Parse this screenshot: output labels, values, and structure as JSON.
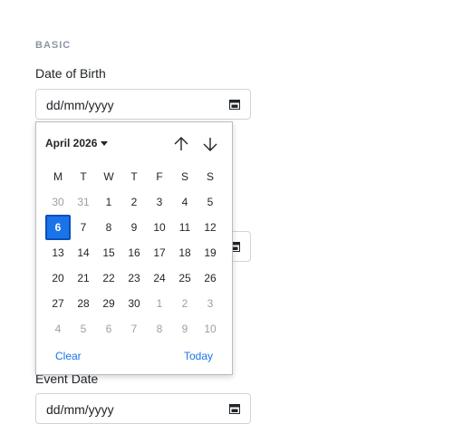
{
  "section": {
    "title": "BASIC"
  },
  "fields": {
    "dob": {
      "label": "Date of Birth",
      "value": "dd/mm/yyyy"
    },
    "event": {
      "label": "Event Date",
      "value": "dd/mm/yyyy"
    }
  },
  "calendar": {
    "month_label": "April 2026",
    "weekdays": [
      "M",
      "T",
      "W",
      "T",
      "F",
      "S",
      "S"
    ],
    "weeks": [
      [
        "30",
        "31",
        "1",
        "2",
        "3",
        "4",
        "5"
      ],
      [
        "6",
        "7",
        "8",
        "9",
        "10",
        "11",
        "12"
      ],
      [
        "13",
        "14",
        "15",
        "16",
        "17",
        "18",
        "19"
      ],
      [
        "20",
        "21",
        "22",
        "23",
        "24",
        "25",
        "26"
      ],
      [
        "27",
        "28",
        "29",
        "30",
        "1",
        "2",
        "3"
      ],
      [
        "4",
        "5",
        "6",
        "7",
        "8",
        "9",
        "10"
      ]
    ],
    "other_month": [
      [
        0,
        0
      ],
      [
        0,
        1
      ],
      [
        4,
        4
      ],
      [
        4,
        5
      ],
      [
        4,
        6
      ],
      [
        5,
        0
      ],
      [
        5,
        1
      ],
      [
        5,
        2
      ],
      [
        5,
        3
      ],
      [
        5,
        4
      ],
      [
        5,
        5
      ],
      [
        5,
        6
      ]
    ],
    "selected": [
      1,
      0
    ],
    "clear_label": "Clear",
    "today_label": "Today",
    "icons": {
      "prev": "arrow-up-icon",
      "next": "arrow-down-icon",
      "month_caret": "caret-down-icon"
    },
    "colors": {
      "accent": "#1a73e8"
    }
  }
}
